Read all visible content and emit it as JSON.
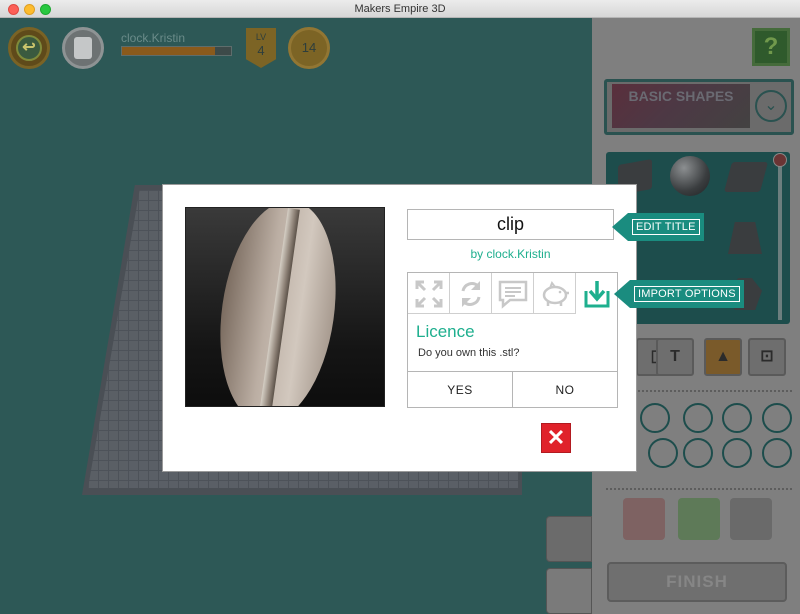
{
  "window": {
    "title": "Makers Empire 3D"
  },
  "hud": {
    "username": "clock.Kristin",
    "xp_progress": 0.85,
    "level_label": "LV",
    "level": "4",
    "coins": "14"
  },
  "side_panel": {
    "help_label": "?",
    "shapes_category": "BASIC SHAPES",
    "finish_label": "FINISH"
  },
  "modal": {
    "title_value": "clip",
    "author": "by clock.Kristin",
    "option_icons": [
      "fullscreen-icon",
      "rotate-icon",
      "comment-icon",
      "piggy-bank-icon",
      "import-icon"
    ],
    "licence_title": "Licence",
    "licence_question": "Do you own this .stl?",
    "yes_label": "YES",
    "no_label": "NO",
    "close_label": "✕"
  },
  "callouts": {
    "edit_title": "EDIT TITLE",
    "import_options": "IMPORT OPTIONS"
  },
  "colors": {
    "accent": "#1eaf8e",
    "callout": "#1a8c7f",
    "close": "#e0222a",
    "workspace": "#2d5856"
  }
}
